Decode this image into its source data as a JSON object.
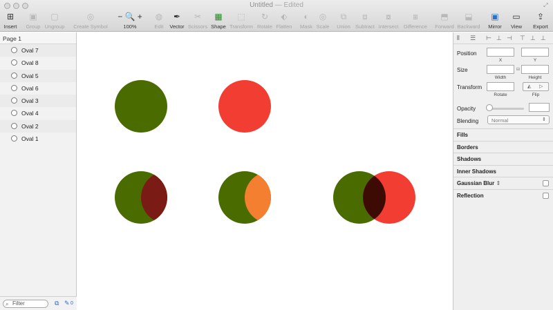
{
  "window": {
    "title": "Untitled",
    "status": "— Edited"
  },
  "toolbar": [
    {
      "label": "Insert",
      "icon": "plus-icon",
      "active": true
    },
    {
      "label": "Group",
      "icon": "group-icon",
      "active": false
    },
    {
      "label": "Ungroup",
      "icon": "ungroup-icon",
      "active": false
    },
    {
      "label": "Create Symbol",
      "icon": "symbol-icon",
      "active": false
    },
    {
      "label": "100%",
      "icon": "zoom-icon",
      "active": true
    },
    {
      "label": "Edit",
      "icon": "edit-icon",
      "active": false
    },
    {
      "label": "Vector",
      "icon": "pen-icon",
      "active": true
    },
    {
      "label": "Scissors",
      "icon": "scissors-icon",
      "active": false
    },
    {
      "label": "Shape",
      "icon": "shape-icon",
      "active": true
    },
    {
      "label": "Transform",
      "icon": "transform-icon",
      "active": false
    },
    {
      "label": "Rotate",
      "icon": "rotate-icon",
      "active": false
    },
    {
      "label": "Flatten",
      "icon": "flatten-icon",
      "active": false
    },
    {
      "label": "Mask",
      "icon": "mask-icon",
      "active": false
    },
    {
      "label": "Scale",
      "icon": "scale-icon",
      "active": false
    },
    {
      "label": "Union",
      "icon": "union-icon",
      "active": false
    },
    {
      "label": "Subtract",
      "icon": "subtract-icon",
      "active": false
    },
    {
      "label": "Intersect",
      "icon": "intersect-icon",
      "active": false
    },
    {
      "label": "Difference",
      "icon": "difference-icon",
      "active": false
    },
    {
      "label": "Forward",
      "icon": "forward-icon",
      "active": false
    },
    {
      "label": "Backward",
      "icon": "backward-icon",
      "active": false
    },
    {
      "label": "Mirror",
      "icon": "mirror-icon",
      "active": true
    },
    {
      "label": "View",
      "icon": "view-icon",
      "active": true
    },
    {
      "label": "Export",
      "icon": "export-icon",
      "active": true
    }
  ],
  "layers": {
    "page": "Page 1",
    "items": [
      "Oval 7",
      "Oval 8",
      "Oval 5",
      "Oval 6",
      "Oval 3",
      "Oval 4",
      "Oval 2",
      "Oval 1"
    ],
    "filter_placeholder": "Filter",
    "edited_count": "0"
  },
  "canvas": {
    "colors": {
      "green": "#4a6b00",
      "red": "#f23d32",
      "dark_red_overlap": "#7a1b15",
      "orange_overlap": "#f47f30",
      "darkest_overlap": "#3d0a04"
    }
  },
  "inspector": {
    "position_label": "Position",
    "x_label": "X",
    "y_label": "Y",
    "size_label": "Size",
    "width_label": "Width",
    "height_label": "Height",
    "transform_label": "Transform",
    "rotate_label": "Rotate",
    "flip_label": "Flip",
    "opacity_label": "Opacity",
    "blending_label": "Blending",
    "blending_value": "Normal",
    "sections": [
      "Fills",
      "Borders",
      "Shadows",
      "Inner Shadows",
      "Gaussian Blur",
      "Reflection"
    ]
  }
}
